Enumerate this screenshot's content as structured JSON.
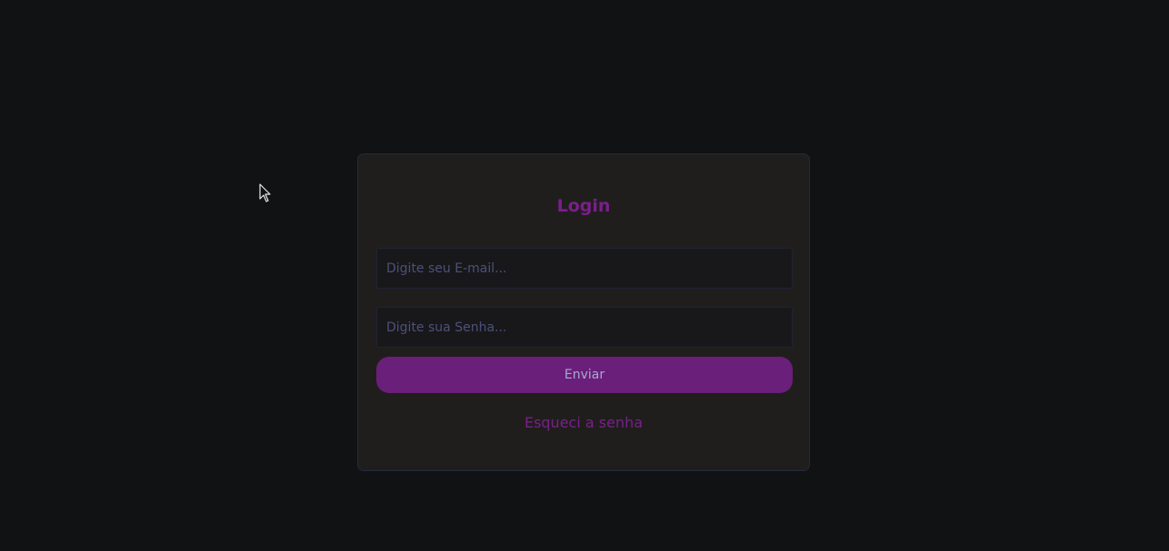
{
  "login": {
    "title": "Login",
    "email_placeholder": "Digite seu E-mail...",
    "password_placeholder": "Digite sua Senha...",
    "submit_label": "Enviar",
    "forgot_label": "Esqueci a senha"
  },
  "colors": {
    "background": "#101213",
    "card": "#201e1d",
    "accent": "#7a1f8c",
    "button": "#6a1f7a"
  }
}
